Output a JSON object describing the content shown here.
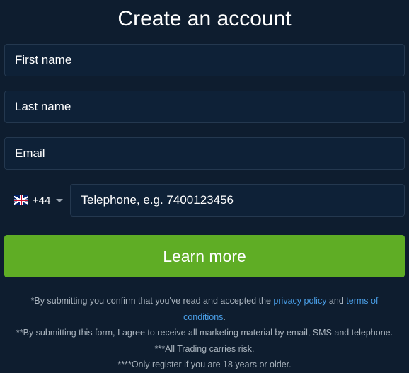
{
  "title": "Create an account",
  "form": {
    "first_name_placeholder": "First name",
    "last_name_placeholder": "Last name",
    "email_placeholder": "Email",
    "phone": {
      "dial_code": "+44",
      "placeholder": "Telephone, e.g. 7400123456"
    },
    "submit_label": "Learn more"
  },
  "disclaimer": {
    "line1_prefix": "*By submitting you confirm that you've read and accepted the ",
    "privacy_link": "privacy policy",
    "line1_mid": " and ",
    "terms_link": "terms of conditions",
    "line1_suffix": ".",
    "line2": "**By submitting this form, I agree to receive all marketing material by email, SMS and telephone.",
    "line3": "***All Trading carries risk.",
    "line4": "****Only register if you are 18 years or older."
  }
}
